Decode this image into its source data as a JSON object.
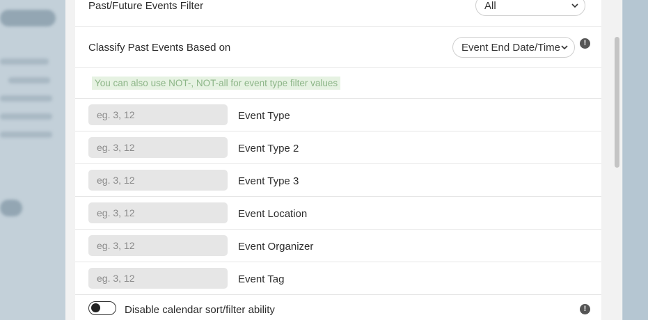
{
  "settings": {
    "past_future_filter": {
      "label": "Past/Future Events Filter",
      "value": "All"
    },
    "classify_past": {
      "label": "Classify Past Events Based on",
      "value": "Event End Date/Time"
    },
    "note": "You can also use NOT-, NOT-all for event type filter values",
    "filters": [
      {
        "label": "Event Type",
        "placeholder": "eg. 3, 12"
      },
      {
        "label": "Event Type 2",
        "placeholder": "eg. 3, 12"
      },
      {
        "label": "Event Type 3",
        "placeholder": "eg. 3, 12"
      },
      {
        "label": "Event Location",
        "placeholder": "eg. 3, 12"
      },
      {
        "label": "Event Organizer",
        "placeholder": "eg. 3, 12"
      },
      {
        "label": "Event Tag",
        "placeholder": "eg. 3, 12"
      }
    ],
    "disable_sort": {
      "label": "Disable calendar sort/filter ability",
      "enabled": false
    }
  },
  "icons": {
    "info": "info-icon",
    "chevron": "chevron-down-icon"
  },
  "colors": {
    "note_bg": "#e6f2e2",
    "note_text": "#8cb587",
    "input_bg": "#e6e6e6",
    "backdrop": "#c3d0d9"
  }
}
